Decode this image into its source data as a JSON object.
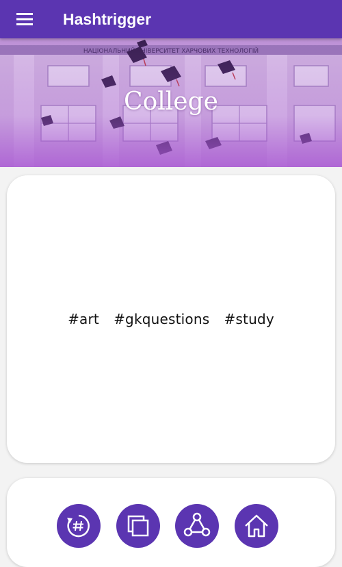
{
  "app": {
    "title": "Hashtrigger"
  },
  "banner": {
    "title": "College"
  },
  "tags": {
    "text": "#art  #gkquestions  #study"
  },
  "actions": [
    {
      "name": "hashtag-refresh",
      "icon": "hashtag-refresh-icon"
    },
    {
      "name": "copy",
      "icon": "copy-icon"
    },
    {
      "name": "share",
      "icon": "share-icon"
    },
    {
      "name": "home",
      "icon": "home-icon"
    }
  ],
  "colors": {
    "primary": "#5b35b1",
    "banner_tint": "#b05ed0",
    "background": "#f3f3f3"
  }
}
